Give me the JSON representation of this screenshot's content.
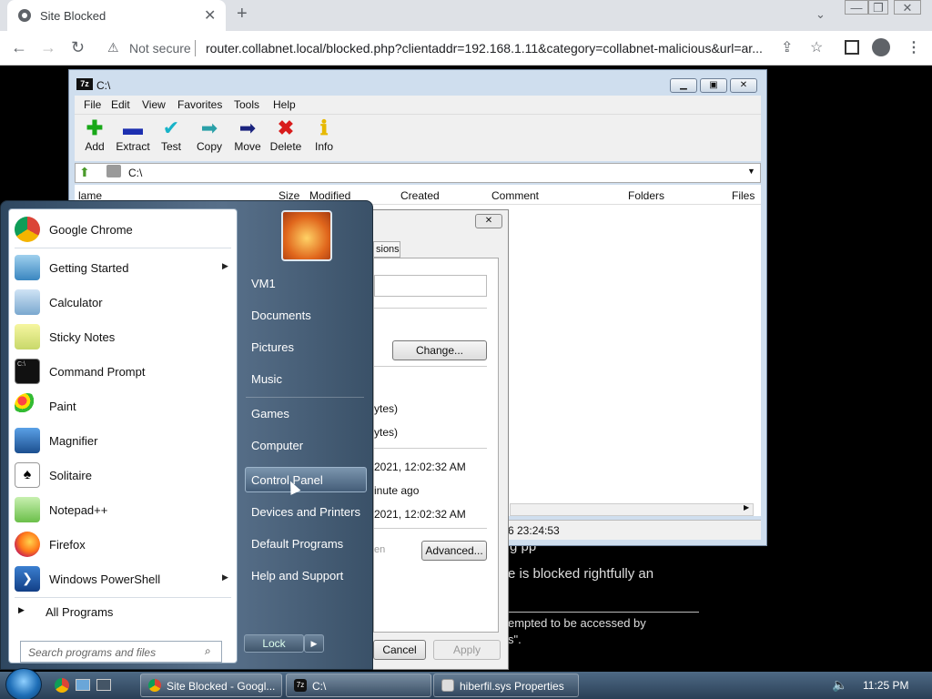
{
  "browser": {
    "tab_title": "Site Blocked",
    "address_warning": "Not secure",
    "url": "router.collabnet.local/blocked.php?clientaddr=192.168.1.11&category=collabnet-malicious&url=ar..."
  },
  "blocked_page": {
    "line1": "e is blocked rightfully an",
    "line2": "empted to be accessed by",
    "line3": "s\".",
    "fragment": "g pp"
  },
  "zip_window": {
    "title": "C:\\",
    "menu": [
      "File",
      "Edit",
      "View",
      "Favorites",
      "Tools",
      "Help"
    ],
    "toolbar": [
      {
        "label": "Add",
        "icon": "plus-icon",
        "color": "#18a818"
      },
      {
        "label": "Extract",
        "icon": "minus-icon",
        "color": "#1c2fb0"
      },
      {
        "label": "Test",
        "icon": "check-icon",
        "color": "#17b3c8"
      },
      {
        "label": "Copy",
        "icon": "copy-arrow-icon",
        "color": "#2aa0a8"
      },
      {
        "label": "Move",
        "icon": "move-arrow-icon",
        "color": "#1a237e"
      },
      {
        "label": "Delete",
        "icon": "delete-x-icon",
        "color": "#d81b1b"
      },
      {
        "label": "Info",
        "icon": "info-icon",
        "color": "#e6b800"
      }
    ],
    "path": "C:\\",
    "columns": [
      "lame",
      "Size",
      "Modified",
      "Created",
      "Comment",
      "Folders",
      "Files"
    ],
    "status_text": "6 23:24:53"
  },
  "properties_dialog": {
    "tab_fragment": "sions",
    "change_button": "Change...",
    "size_line1": "ytes)",
    "size_line2": "ytes)",
    "created": "2021, 12:02:32 AM",
    "modified": "inute ago",
    "accessed": "2021, 12:02:32 AM",
    "attr_fragment": "en",
    "advanced_button": "Advanced...",
    "cancel_button": "Cancel",
    "apply_button": "Apply"
  },
  "start_menu": {
    "programs": [
      {
        "label": "Google Chrome",
        "icon": "chrome-icon",
        "submenu": false
      },
      {
        "label": "Getting Started",
        "icon": "getting-started-icon",
        "submenu": true
      },
      {
        "label": "Calculator",
        "icon": "calculator-icon",
        "submenu": false
      },
      {
        "label": "Sticky Notes",
        "icon": "sticky-notes-icon",
        "submenu": false
      },
      {
        "label": "Command Prompt",
        "icon": "command-prompt-icon",
        "submenu": false
      },
      {
        "label": "Paint",
        "icon": "paint-icon",
        "submenu": false
      },
      {
        "label": "Magnifier",
        "icon": "magnifier-icon",
        "submenu": false
      },
      {
        "label": "Solitaire",
        "icon": "solitaire-icon",
        "submenu": false
      },
      {
        "label": "Notepad++",
        "icon": "notepadpp-icon",
        "submenu": false
      },
      {
        "label": "Firefox",
        "icon": "firefox-icon",
        "submenu": false
      },
      {
        "label": "Windows PowerShell",
        "icon": "powershell-icon",
        "submenu": true
      }
    ],
    "all_programs": "All Programs",
    "search_placeholder": "Search programs and files",
    "right": [
      "VM1",
      "Documents",
      "Pictures",
      "Music",
      "Games",
      "Computer",
      "Control Panel",
      "Devices and Printers",
      "Default Programs",
      "Help and Support"
    ],
    "lock_label": "Lock"
  },
  "taskbar": {
    "items": [
      "Site Blocked - Googl...",
      "C:\\",
      "hiberfil.sys Properties"
    ],
    "clock": "11:25 PM"
  }
}
